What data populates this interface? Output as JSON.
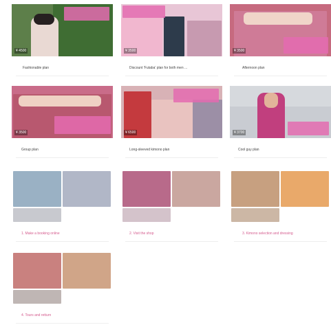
{
  "plans": [
    {
      "label": "Fashionable plan",
      "price": "¥ 4500"
    },
    {
      "label": "Discount 'Futaba' plan for both men ...",
      "price": "¥ 3500"
    },
    {
      "label": "Afternoon plan",
      "price": "¥ 3500"
    },
    {
      "label": "Group plan",
      "price": "¥ 3500"
    },
    {
      "label": "Long-sleeved kimono plan",
      "price": "¥ 6500"
    },
    {
      "label": "Cool guy plan",
      "price": "¥ 3700"
    }
  ],
  "steps": [
    {
      "label": "1. Make a booking online"
    },
    {
      "label": "2. Visit the shop"
    },
    {
      "label": "3. Kimono selection and dressing"
    },
    {
      "label": "4. Tours and retturn"
    }
  ],
  "colors": {
    "accent_pink": "#e46bb0",
    "step_label_pink": "#d45a8d"
  }
}
